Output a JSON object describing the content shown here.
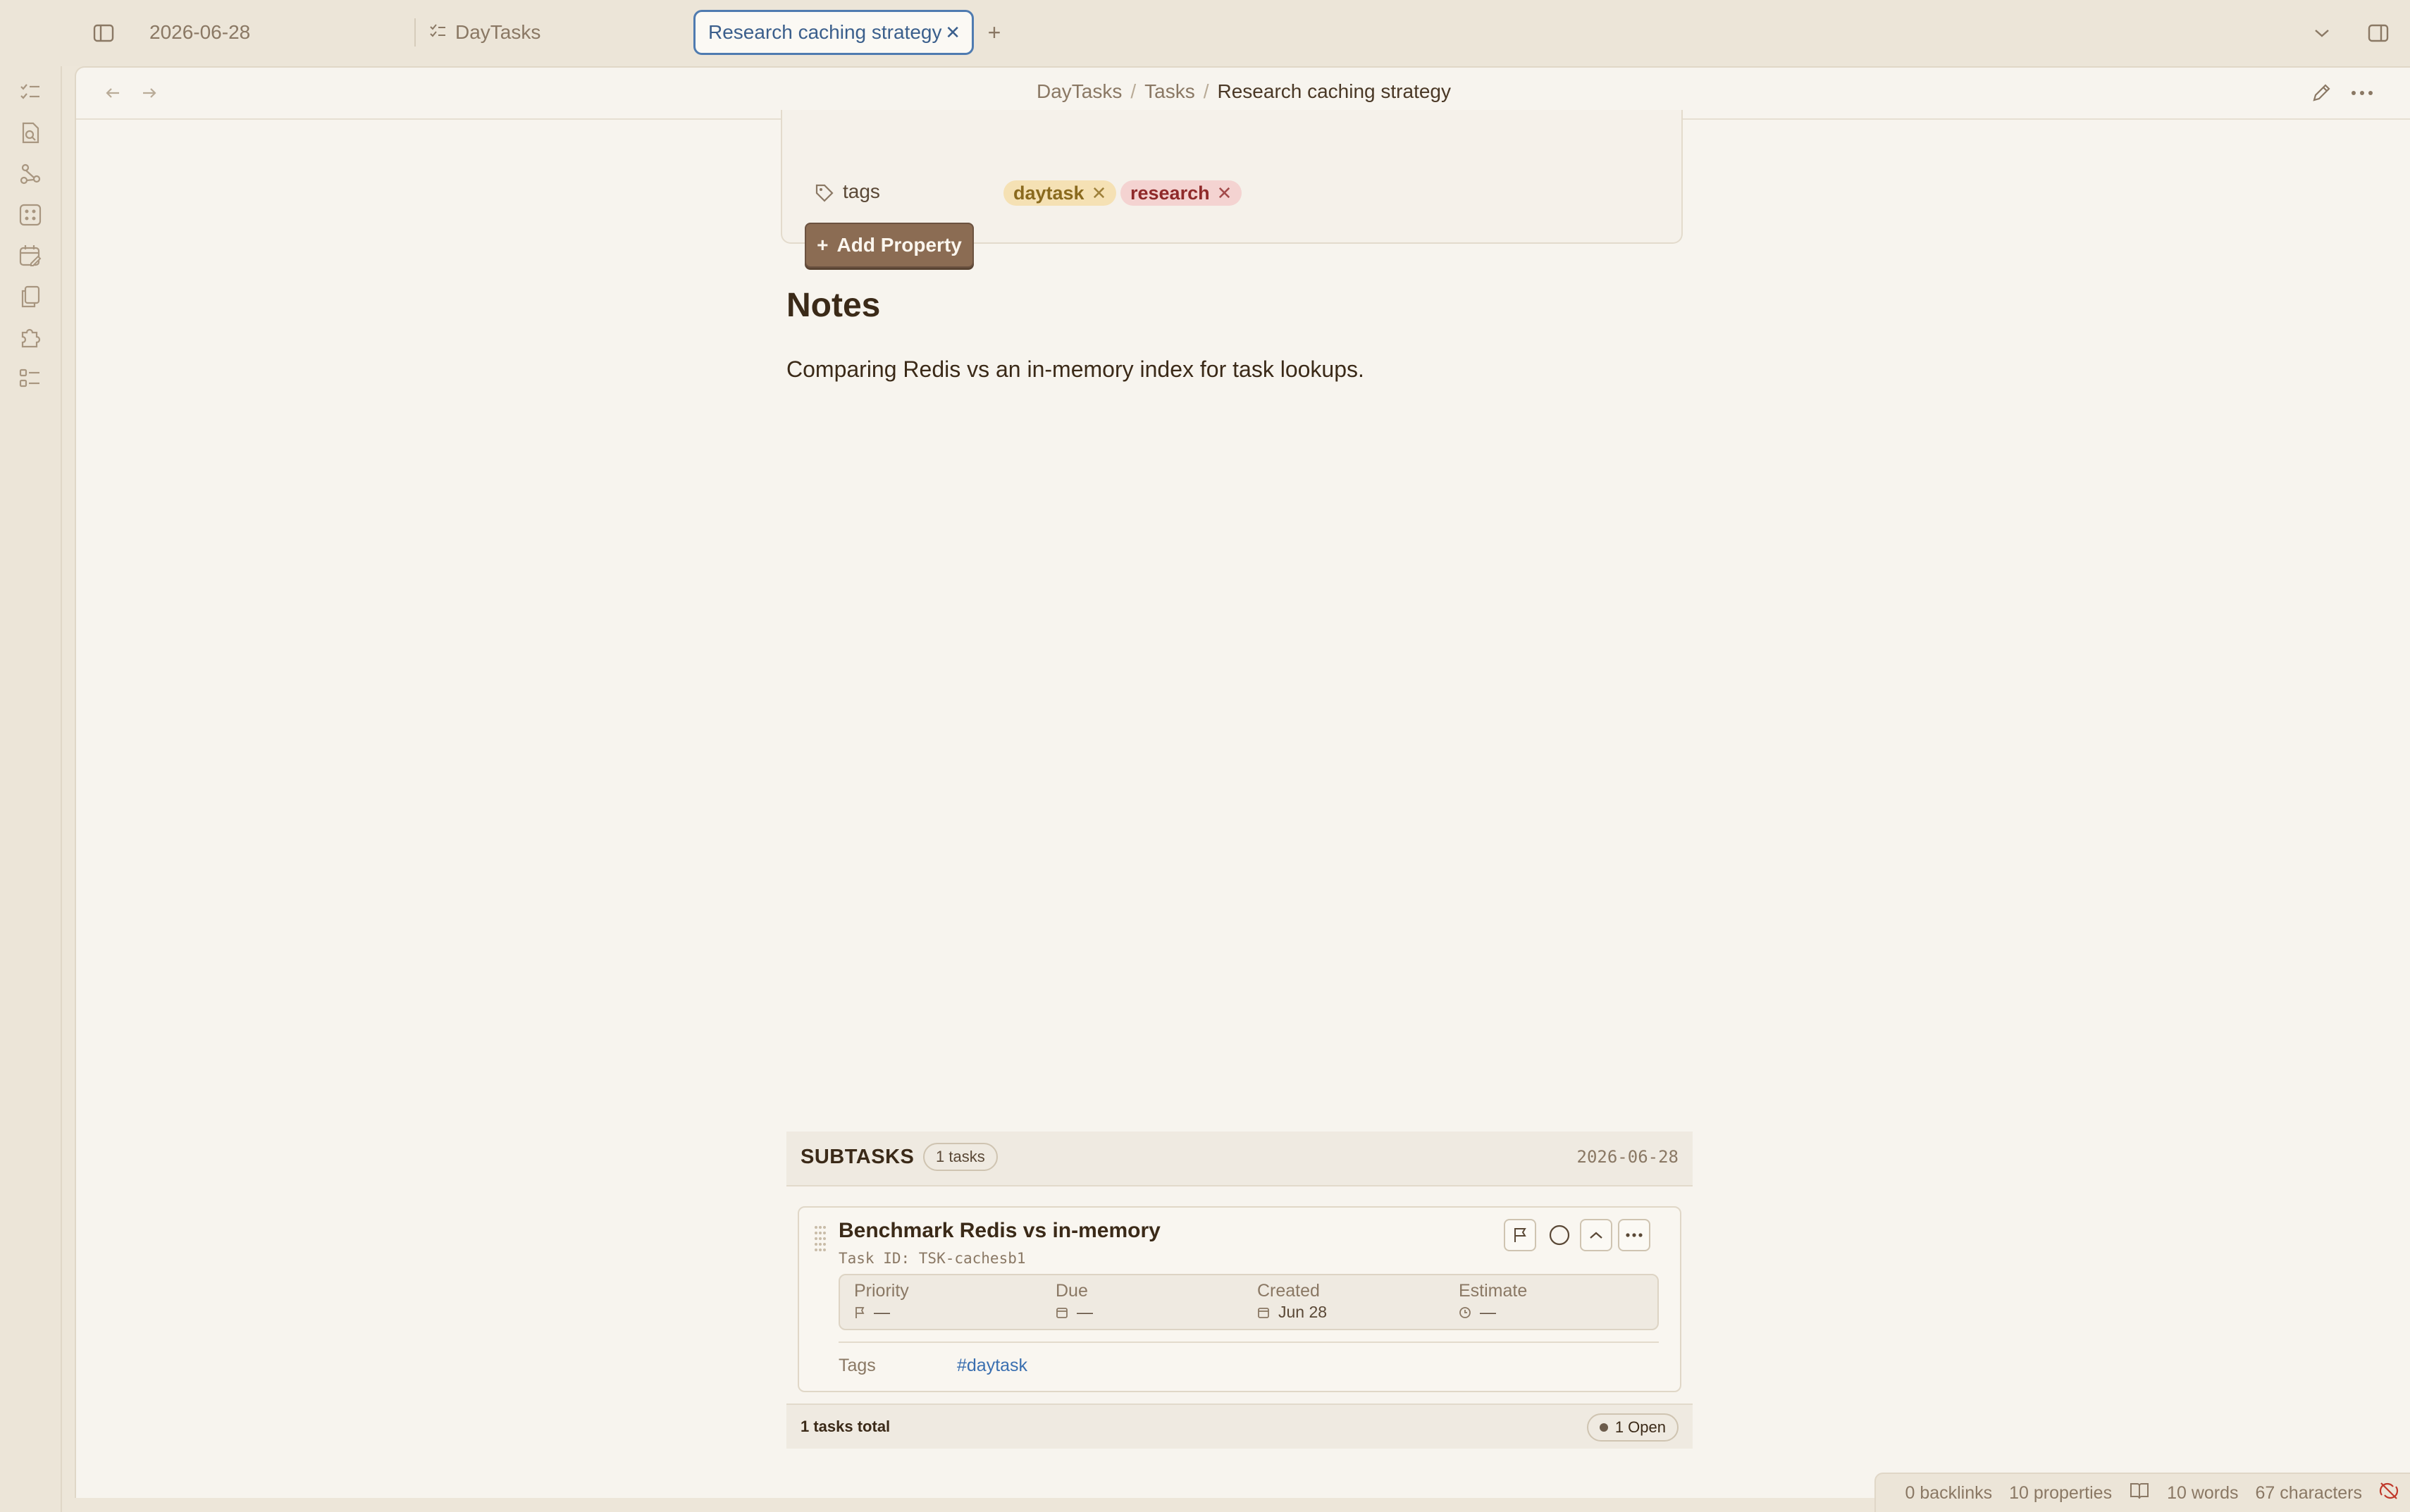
{
  "tabs": [
    {
      "label": "2026-06-28",
      "active": false
    },
    {
      "label": "DayTasks",
      "active": false
    },
    {
      "label": "Research caching strategy",
      "active": true
    }
  ],
  "breadcrumb": {
    "root": "DayTasks",
    "folder": "Tasks",
    "current": "Research caching strategy",
    "separator": "/"
  },
  "properties": {
    "tags_label": "tags",
    "tags": [
      {
        "label": "daytask",
        "color": "#f5e1b4"
      },
      {
        "label": "research",
        "color": "#f4d3d1"
      }
    ],
    "add_property_label": "Add Property",
    "plus": "+"
  },
  "notes": {
    "heading": "Notes",
    "body": "Comparing Redis vs an in-memory index for task lookups."
  },
  "subtasks": {
    "title": "SUBTASKS",
    "count_badge": "1 tasks",
    "date": "2026-06-28",
    "tasks": [
      {
        "title": "Benchmark Redis vs in-memory",
        "task_id": "Task ID: TSK-cachesb1",
        "meta": [
          {
            "label": "Priority",
            "value": "—",
            "icon": "flag-icon"
          },
          {
            "label": "Due",
            "value": "—",
            "icon": "calendar-icon"
          },
          {
            "label": "Created",
            "value": "Jun 28",
            "icon": "calendar-icon"
          },
          {
            "label": "Estimate",
            "value": "—",
            "icon": "clock-icon"
          }
        ],
        "tags_label": "Tags",
        "tags": "#daytask"
      }
    ],
    "footer_total": "1 tasks total",
    "footer_open": "1 Open"
  },
  "statusbar": {
    "backlinks": "0 backlinks",
    "properties": "10 properties",
    "words": "10 words",
    "characters": "67 characters"
  },
  "colors": {
    "accent": "#4f7bb0",
    "button": "#8b6c53",
    "background": "#f7f4ee"
  }
}
